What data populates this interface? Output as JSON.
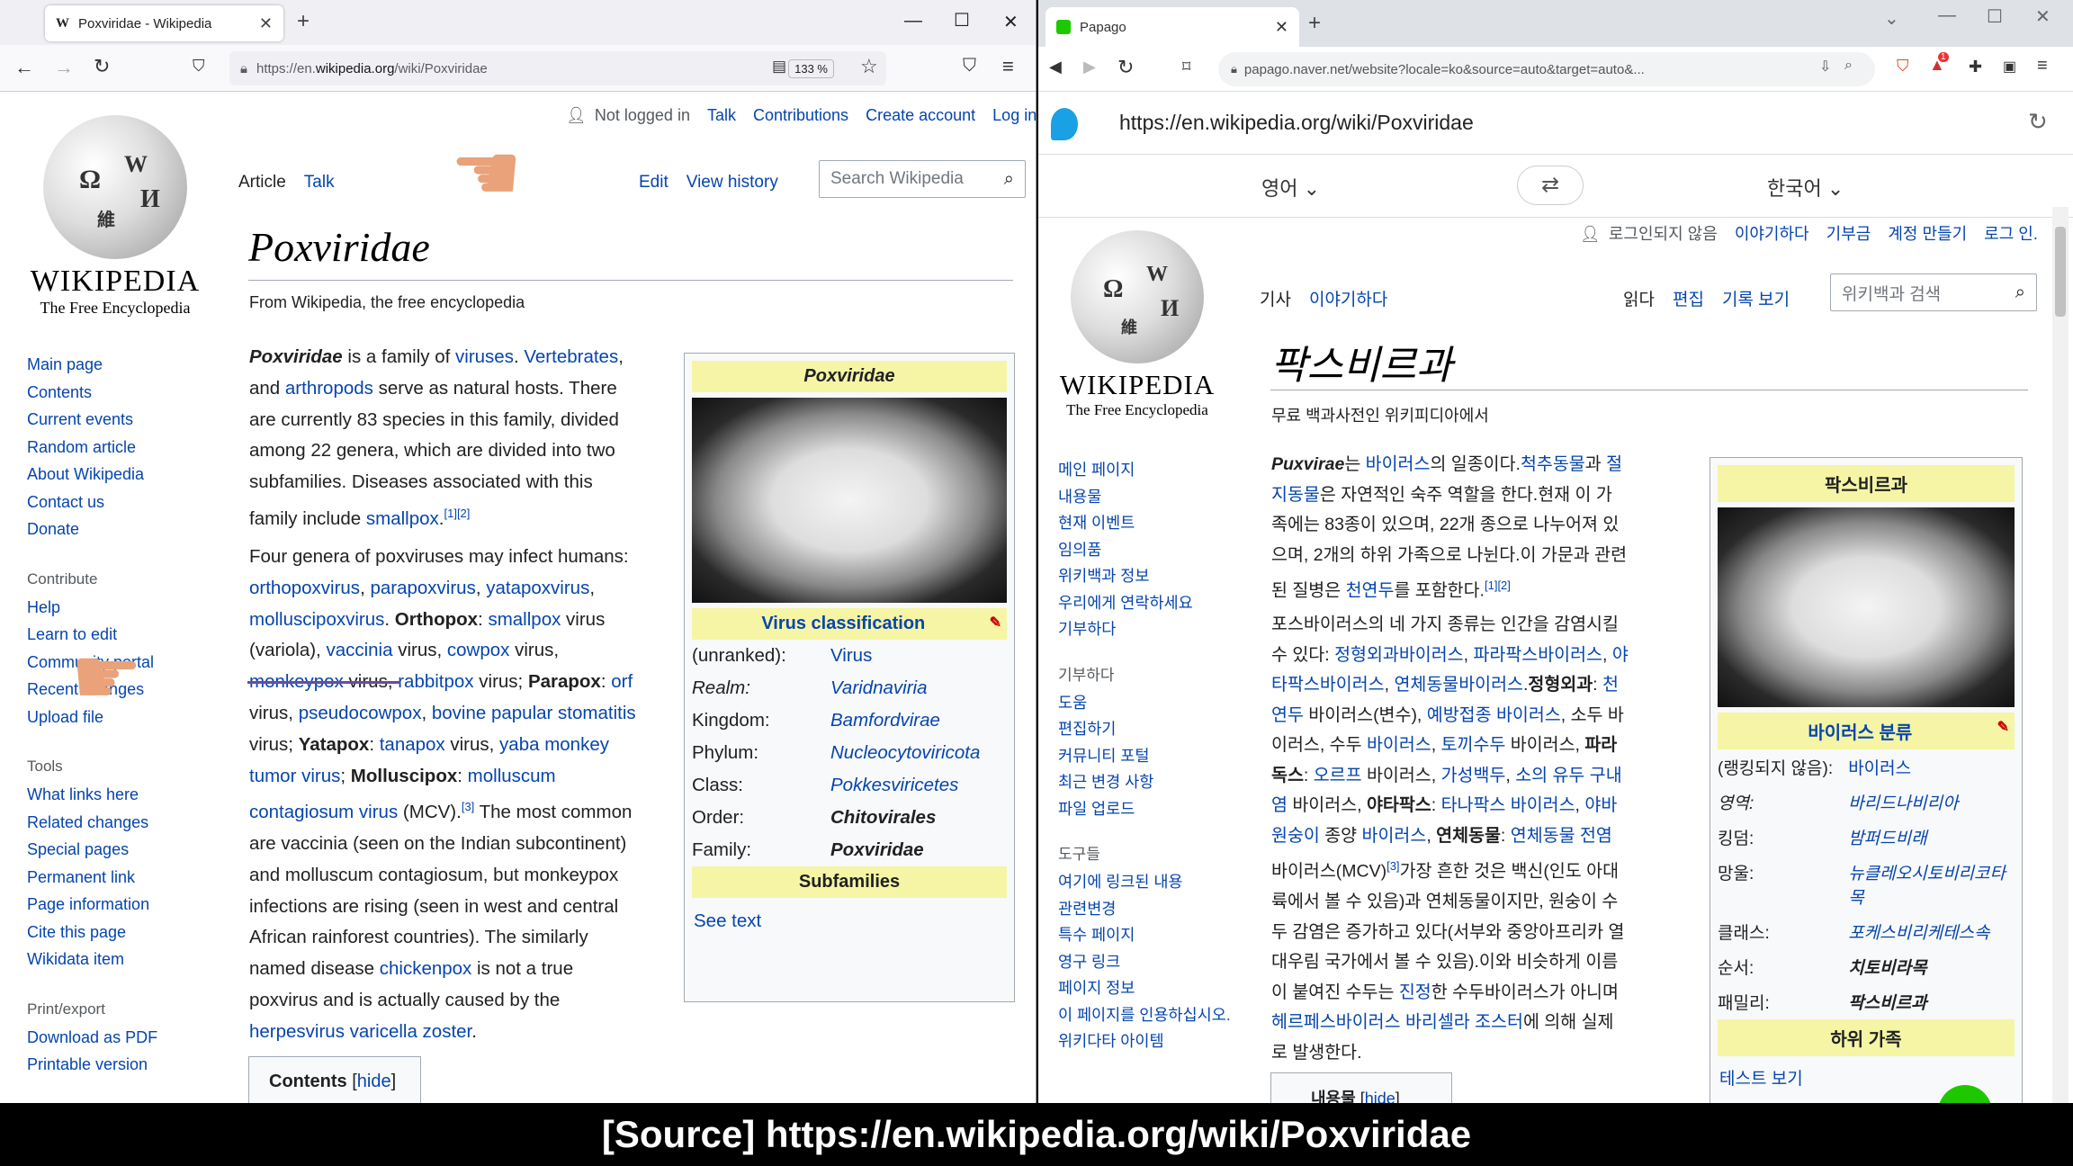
{
  "firefox": {
    "tab_title": "Poxviridae - Wikipedia",
    "tab_icon": "W",
    "url_prefix": "https://en.",
    "url_domain": "wikipedia.org",
    "url_path": "/wiki/Poxviridae",
    "zoom": "133 %"
  },
  "wiki_en": {
    "logo_word": "WIKIPEDIA",
    "logo_tag": "The Free Encyclopedia",
    "user": {
      "not_logged": "Not logged in",
      "talk": "Talk",
      "contributions": "Contributions",
      "create": "Create account",
      "login": "Log in"
    },
    "tabs": {
      "article": "Article",
      "talk": "Talk",
      "edit": "Edit",
      "history": "View history"
    },
    "search_placeholder": "Search Wikipedia",
    "nav": [
      "Main page",
      "Contents",
      "Current events",
      "Random article",
      "About Wikipedia",
      "Contact us",
      "Donate"
    ],
    "contribute_head": "Contribute",
    "contribute": [
      "Help",
      "Learn to edit",
      "Community portal",
      "Recent changes",
      "Upload file"
    ],
    "tools_head": "Tools",
    "tools": [
      "What links here",
      "Related changes",
      "Special pages",
      "Permanent link",
      "Page information",
      "Cite this page",
      "Wikidata item"
    ],
    "print_head": "Print/export",
    "print": [
      "Download as PDF",
      "Printable version"
    ],
    "title": "Poxviridae",
    "from": "From Wikipedia, the free encyclopedia",
    "p1": [
      [
        "b",
        "Poxviridae"
      ],
      [
        "t",
        " is a family of "
      ],
      [
        "l",
        "viruses"
      ],
      [
        "t",
        ". "
      ],
      [
        "l",
        "Vertebrates"
      ],
      [
        "t",
        ","
      ],
      [
        "br"
      ],
      [
        "t",
        "and "
      ],
      [
        "l",
        "arthropods"
      ],
      [
        "t",
        " serve as natural hosts. There"
      ],
      [
        "br"
      ],
      [
        "t",
        "are currently 83 species in this family, divided"
      ],
      [
        "br"
      ],
      [
        "t",
        "among 22 genera, which are divided into two"
      ],
      [
        "br"
      ],
      [
        "t",
        "subfamilies. Diseases associated with this"
      ],
      [
        "br"
      ],
      [
        "t",
        "family include "
      ],
      [
        "l",
        "smallpox"
      ],
      [
        "t",
        "."
      ],
      [
        "s",
        "[1][2]"
      ]
    ],
    "p2": [
      [
        "t",
        "Four genera of poxviruses may infect humans:"
      ],
      [
        "br"
      ],
      [
        "l",
        "orthopoxvirus"
      ],
      [
        "t",
        ", "
      ],
      [
        "l",
        "parapoxvirus"
      ],
      [
        "t",
        ", "
      ],
      [
        "l",
        "yatapoxvirus"
      ],
      [
        "t",
        ","
      ],
      [
        "br"
      ],
      [
        "l",
        "molluscipoxvirus"
      ],
      [
        "t",
        ". "
      ],
      [
        "b2",
        "Orthopox"
      ],
      [
        "t",
        ": "
      ],
      [
        "l",
        "smallpox"
      ],
      [
        "t",
        " virus"
      ],
      [
        "br"
      ],
      [
        "t",
        "(variola), "
      ],
      [
        "l",
        "vaccinia"
      ],
      [
        "t",
        " virus, "
      ],
      [
        "l",
        "cowpox"
      ],
      [
        "t",
        " virus,"
      ],
      [
        "br"
      ],
      [
        "l",
        "monkeypox"
      ],
      [
        "t",
        " virus, "
      ],
      [
        "l",
        "rabbitpox"
      ],
      [
        "t",
        " virus; "
      ],
      [
        "b2",
        "Parapox"
      ],
      [
        "t",
        ": "
      ],
      [
        "l",
        "orf"
      ],
      [
        "br"
      ],
      [
        "t",
        "virus, "
      ],
      [
        "l",
        "pseudocowpox"
      ],
      [
        "t",
        ", "
      ],
      [
        "l",
        "bovine papular stomatitis"
      ],
      [
        "br"
      ],
      [
        "t",
        "virus; "
      ],
      [
        "b2",
        "Yatapox"
      ],
      [
        "t",
        ": "
      ],
      [
        "l",
        "tanapox"
      ],
      [
        "t",
        " virus, "
      ],
      [
        "l",
        "yaba monkey"
      ],
      [
        "br"
      ],
      [
        "l",
        "tumor virus"
      ],
      [
        "t",
        "; "
      ],
      [
        "b2",
        "Molluscipox"
      ],
      [
        "t",
        ": "
      ],
      [
        "l",
        "molluscum"
      ],
      [
        "br"
      ],
      [
        "l",
        "contagiosum virus"
      ],
      [
        "t",
        " (MCV)."
      ],
      [
        "s",
        "[3]"
      ],
      [
        "t",
        " The most common"
      ],
      [
        "br"
      ],
      [
        "t",
        "are vaccinia (seen on the Indian subcontinent)"
      ],
      [
        "br"
      ],
      [
        "t",
        "and molluscum contagiosum, but monkeypox"
      ],
      [
        "br"
      ],
      [
        "t",
        "infections are rising (seen in west and central"
      ],
      [
        "br"
      ],
      [
        "t",
        "African rainforest countries). The similarly"
      ],
      [
        "br"
      ],
      [
        "t",
        "named disease "
      ],
      [
        "l",
        "chickenpox"
      ],
      [
        "t",
        " is not a true"
      ],
      [
        "br"
      ],
      [
        "t",
        "poxvirus and is actually caused by the"
      ],
      [
        "br"
      ],
      [
        "l",
        "herpesvirus varicella zoster"
      ],
      [
        "t",
        "."
      ]
    ],
    "contents_label": "Contents",
    "contents_hide": "hide",
    "infobox": {
      "title": "Poxviridae",
      "classification": "Virus classification",
      "rows": [
        {
          "k": "(unranked):",
          "v": "Virus",
          "style": "plain"
        },
        {
          "k": "Realm:",
          "v": "Varidnaviria",
          "style": "italic",
          "kstyle": "italic"
        },
        {
          "k": "Kingdom:",
          "v": "Bamfordvirae",
          "style": "italic"
        },
        {
          "k": "Phylum:",
          "v": "Nucleocytoviricota",
          "style": "italic"
        },
        {
          "k": "Class:",
          "v": "Pokkesviricetes",
          "style": "italic"
        },
        {
          "k": "Order:",
          "v": "Chitovirales",
          "style": "bold"
        },
        {
          "k": "Family:",
          "v": "Poxviridae",
          "style": "bold"
        }
      ],
      "subfamilies": "Subfamilies",
      "see_text": "See text"
    }
  },
  "chrome": {
    "tab_title": "Papago",
    "url": "papago.naver.net/website?locale=ko&source=auto&target=auto&...",
    "badge_count": "1"
  },
  "papago": {
    "url": "https://en.wikipedia.org/wiki/Poxviridae",
    "source_lang": "영어",
    "target_lang": "한국어"
  },
  "wiki_ko": {
    "user": {
      "not_logged": "로그인되지 않음",
      "talk": "이야기하다",
      "contrib": "기부금",
      "create": "계정 만들기",
      "login": "로그 인."
    },
    "tabs": {
      "article": "기사",
      "talk": "이야기하다",
      "read": "읽다",
      "edit": "편집",
      "history": "기록 보기"
    },
    "search_placeholder": "위키백과 검색",
    "nav": [
      "메인 페이지",
      "내용물",
      "현재 이벤트",
      "임의품",
      "위키백과 정보",
      "우리에게 연락하세요",
      "기부하다"
    ],
    "contribute_head": "기부하다",
    "contribute": [
      "도움",
      "편집하기",
      "커뮤니티 포털",
      "최근 변경 사항",
      "파일 업로드"
    ],
    "tools_head": "도구들",
    "tools": [
      "여기에 링크된 내용",
      "관련변경",
      "특수 페이지",
      "영구 링크",
      "페이지 정보",
      "이 페이지를 인용하십시오.",
      "위키다타 아이템"
    ],
    "title": "팍스비르과",
    "from": "무료 백과사전인 위키피디아에서",
    "p1": [
      [
        "b",
        "Puxvirae"
      ],
      [
        "t",
        "는 "
      ],
      [
        "l",
        "바이러스"
      ],
      [
        "t",
        "의 일종이다."
      ],
      [
        "l",
        "척추동물"
      ],
      [
        "t",
        "과 "
      ],
      [
        "l",
        "절"
      ],
      [
        "br"
      ],
      [
        "l",
        "지동물"
      ],
      [
        "t",
        "은 자연적인 숙주 역할을 한다.현재 이 가"
      ],
      [
        "br"
      ],
      [
        "t",
        "족에는 83종이 있으며, 22개 종으로 나누어져 있"
      ],
      [
        "br"
      ],
      [
        "t",
        "으며, 2개의 하위 가족으로 나뉜다.이 가문과 관련"
      ],
      [
        "br"
      ],
      [
        "t",
        "된 질병은 "
      ],
      [
        "l",
        "천연두"
      ],
      [
        "t",
        "를 포함한다."
      ],
      [
        "s",
        "[1][2]"
      ]
    ],
    "p2": [
      [
        "t",
        "포스바이러스의 네 가지 종류는 인간을 감염시킬"
      ],
      [
        "br"
      ],
      [
        "t",
        "수 있다: "
      ],
      [
        "l",
        "정형외과바이러스"
      ],
      [
        "t",
        ", "
      ],
      [
        "l",
        "파라팍스바이러스"
      ],
      [
        "t",
        ", "
      ],
      [
        "l",
        "야"
      ],
      [
        "br"
      ],
      [
        "l",
        "타팍스바이러스"
      ],
      [
        "t",
        ", "
      ],
      [
        "l",
        "연체동물바이러스"
      ],
      [
        "t",
        "."
      ],
      [
        "b2",
        "정형외과"
      ],
      [
        "t",
        ": "
      ],
      [
        "l",
        "천"
      ],
      [
        "br"
      ],
      [
        "l",
        "연두"
      ],
      [
        "t",
        " 바이러스(변수), "
      ],
      [
        "l",
        "예방접종 바이러스"
      ],
      [
        "t",
        ", 소두 바"
      ],
      [
        "br"
      ],
      [
        "t",
        "이러스, 수두 "
      ],
      [
        "l",
        "바이러스"
      ],
      [
        "t",
        ", "
      ],
      [
        "l",
        "토끼수두"
      ],
      [
        "t",
        " 바이러스, "
      ],
      [
        "b2",
        "파라"
      ],
      [
        "br"
      ],
      [
        "b2",
        "독스"
      ],
      [
        "t",
        ": "
      ],
      [
        "l",
        "오르프"
      ],
      [
        "t",
        " 바이러스, "
      ],
      [
        "l",
        "가성백두"
      ],
      [
        "t",
        ", "
      ],
      [
        "l",
        "소의 유두 구내"
      ],
      [
        "br"
      ],
      [
        "l",
        "염"
      ],
      [
        "t",
        " 바이러스, "
      ],
      [
        "b2",
        "야타팍스"
      ],
      [
        "t",
        ": "
      ],
      [
        "l",
        "타나팍스 바이러스"
      ],
      [
        "t",
        ", "
      ],
      [
        "l",
        "야바"
      ],
      [
        "br"
      ],
      [
        "l",
        "원숭이"
      ],
      [
        "t",
        " 종양 "
      ],
      [
        "l",
        "바이러스"
      ],
      [
        "t",
        ", "
      ],
      [
        "b2",
        "연체동물"
      ],
      [
        "t",
        ": "
      ],
      [
        "l",
        "연체동물 전염"
      ],
      [
        "br"
      ],
      [
        "t",
        "바이러스(MCV)"
      ],
      [
        "s",
        "[3]"
      ],
      [
        "t",
        "가장 흔한 것은 백신(인도 아대"
      ],
      [
        "br"
      ],
      [
        "t",
        "륙에서 볼 수 있음)과 연체동물이지만, 원숭이 수"
      ],
      [
        "br"
      ],
      [
        "t",
        "두 감염은 증가하고 있다(서부와 중앙아프리카 열"
      ],
      [
        "br"
      ],
      [
        "t",
        "대우림 국가에서 볼 수 있음).이와 비슷하게 이름"
      ],
      [
        "br"
      ],
      [
        "t",
        "이 붙여진 수두는 "
      ],
      [
        "l",
        "진정"
      ],
      [
        "t",
        "한 수두바이러스가 아니며"
      ],
      [
        "br"
      ],
      [
        "l",
        "헤르페스바이러스 바리셀라 조스터"
      ],
      [
        "t",
        "에 의해 실제"
      ],
      [
        "br"
      ],
      [
        "t",
        "로 발생한다."
      ]
    ],
    "contents_label": "내용물",
    "contents_hide": "hide",
    "infobox": {
      "title": "팍스비르과",
      "classification": "바이러스 분류",
      "rows": [
        {
          "k": "(랭킹되지 않음):",
          "v": "바이러스",
          "style": "plain"
        },
        {
          "k": "영역:",
          "v": "바리드나비리아",
          "style": "italic",
          "kstyle": "italic"
        },
        {
          "k": "킹덤:",
          "v": "밤퍼드비래",
          "style": "italic"
        },
        {
          "k": "망울:",
          "v": "뉴클레오시토비리코타목",
          "style": "italic"
        },
        {
          "k": "클래스:",
          "v": "포케스비리케테스속",
          "style": "italic"
        },
        {
          "k": "순서:",
          "v": "치토비라목",
          "style": "bold"
        },
        {
          "k": "패밀리:",
          "v": "팍스비르과",
          "style": "bold"
        }
      ],
      "subfamilies": "하위 가족",
      "see_text": "테스트 보기"
    }
  },
  "caption": "[Source]  https://en.wikipedia.org/wiki/Poxviridae",
  "colors": {
    "link": "#0645ad",
    "infobox_header": "#f5f5a5",
    "caption_bg": "#000000"
  }
}
